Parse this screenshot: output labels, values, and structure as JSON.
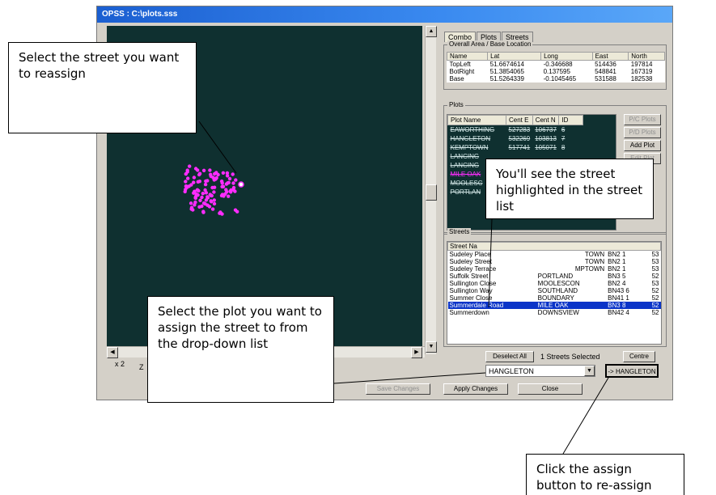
{
  "window": {
    "title": "OPSS : C:\\plots.sss"
  },
  "map": {
    "zoom_label": "x 2",
    "zoom_short": "Z"
  },
  "tabs": [
    {
      "label": "Combo"
    },
    {
      "label": "Plots"
    },
    {
      "label": "Streets"
    }
  ],
  "overall_area": {
    "title": "Overall Area / Base Location",
    "headers": [
      "Name",
      "Lat",
      "Long",
      "East",
      "North"
    ],
    "rows": [
      [
        "TopLeft",
        "51.6674614",
        "-0.346688",
        "514436",
        "197814"
      ],
      [
        "BotRight",
        "51.3854065",
        "0.137595",
        "548841",
        "167319"
      ],
      [
        "Base",
        "51.5264339",
        "-0.1045465",
        "531588",
        "182538"
      ]
    ]
  },
  "plots": {
    "title": "Plots",
    "headers": [
      "Plot Name",
      "Cent E",
      "Cent N",
      "ID"
    ],
    "rows": [
      [
        "EAWORTHING",
        "527283",
        "106737",
        "6"
      ],
      [
        "HANGLETON",
        "532269",
        "103813",
        "7"
      ],
      [
        "KEMPTOWN",
        "517741",
        "105071",
        "8"
      ],
      [
        "LANCING",
        "",
        "",
        ""
      ],
      [
        "LANCING",
        "",
        "",
        ""
      ],
      [
        "MILE OAK",
        "",
        "",
        ""
      ],
      [
        "MOOLESC",
        "",
        "",
        ""
      ],
      [
        "PORTLAN",
        "",
        "",
        ""
      ]
    ],
    "buttons": {
      "pc": "P/C Plots",
      "pd": "P/D Plots",
      "add": "Add Plot",
      "edit": "Edit Plot"
    }
  },
  "streets": {
    "title": "Streets",
    "header": "Street Na",
    "rows": [
      [
        "Sudeley Place",
        "TOWN",
        "BN2 1",
        "53"
      ],
      [
        "Sudeley Street",
        "TOWN",
        "BN2 1",
        "53"
      ],
      [
        "Sudeley Terrace",
        "MPTOWN",
        "BN2 1",
        "53"
      ],
      [
        "Suffolk Street",
        "PORTLAND",
        "BN3 5",
        "52"
      ],
      [
        "Sullington Close",
        "MOOLESCON",
        "BN2 4",
        "53"
      ],
      [
        "Sullington Way",
        "SOUTHLAND",
        "BN43 6",
        "52"
      ],
      [
        "Summer Close",
        "BOUNDARY",
        "BN41 1",
        "52"
      ],
      [
        "Summerdale Road",
        "MILE OAK",
        "BN3 8",
        "52"
      ],
      [
        "Summerdown",
        "DOWNSVIEW",
        "BN42 4",
        "52"
      ]
    ]
  },
  "controls": {
    "deselect_all": "Deselect All",
    "selected_count": "1 Streets Selected",
    "centre": "Centre",
    "plot_value": "HANGLETON",
    "assign_button": "-> HANGLETON",
    "save_changes": "Save Changes",
    "apply_changes": "Apply Changes",
    "close": "Close"
  },
  "callouts": {
    "select_street": "Select the street you want to reassign",
    "highlighted": "You'll see the street highlighted in the street list",
    "select_plot": "Select the plot you want to assign the street to from the drop-down list",
    "click_assign": "Click the assign button to re-assign the street"
  },
  "colors": {
    "map_bg": "#0f3030",
    "points": "#ff2cff",
    "selection": "#0a34c8",
    "title_bar": "#1b5fd1"
  }
}
